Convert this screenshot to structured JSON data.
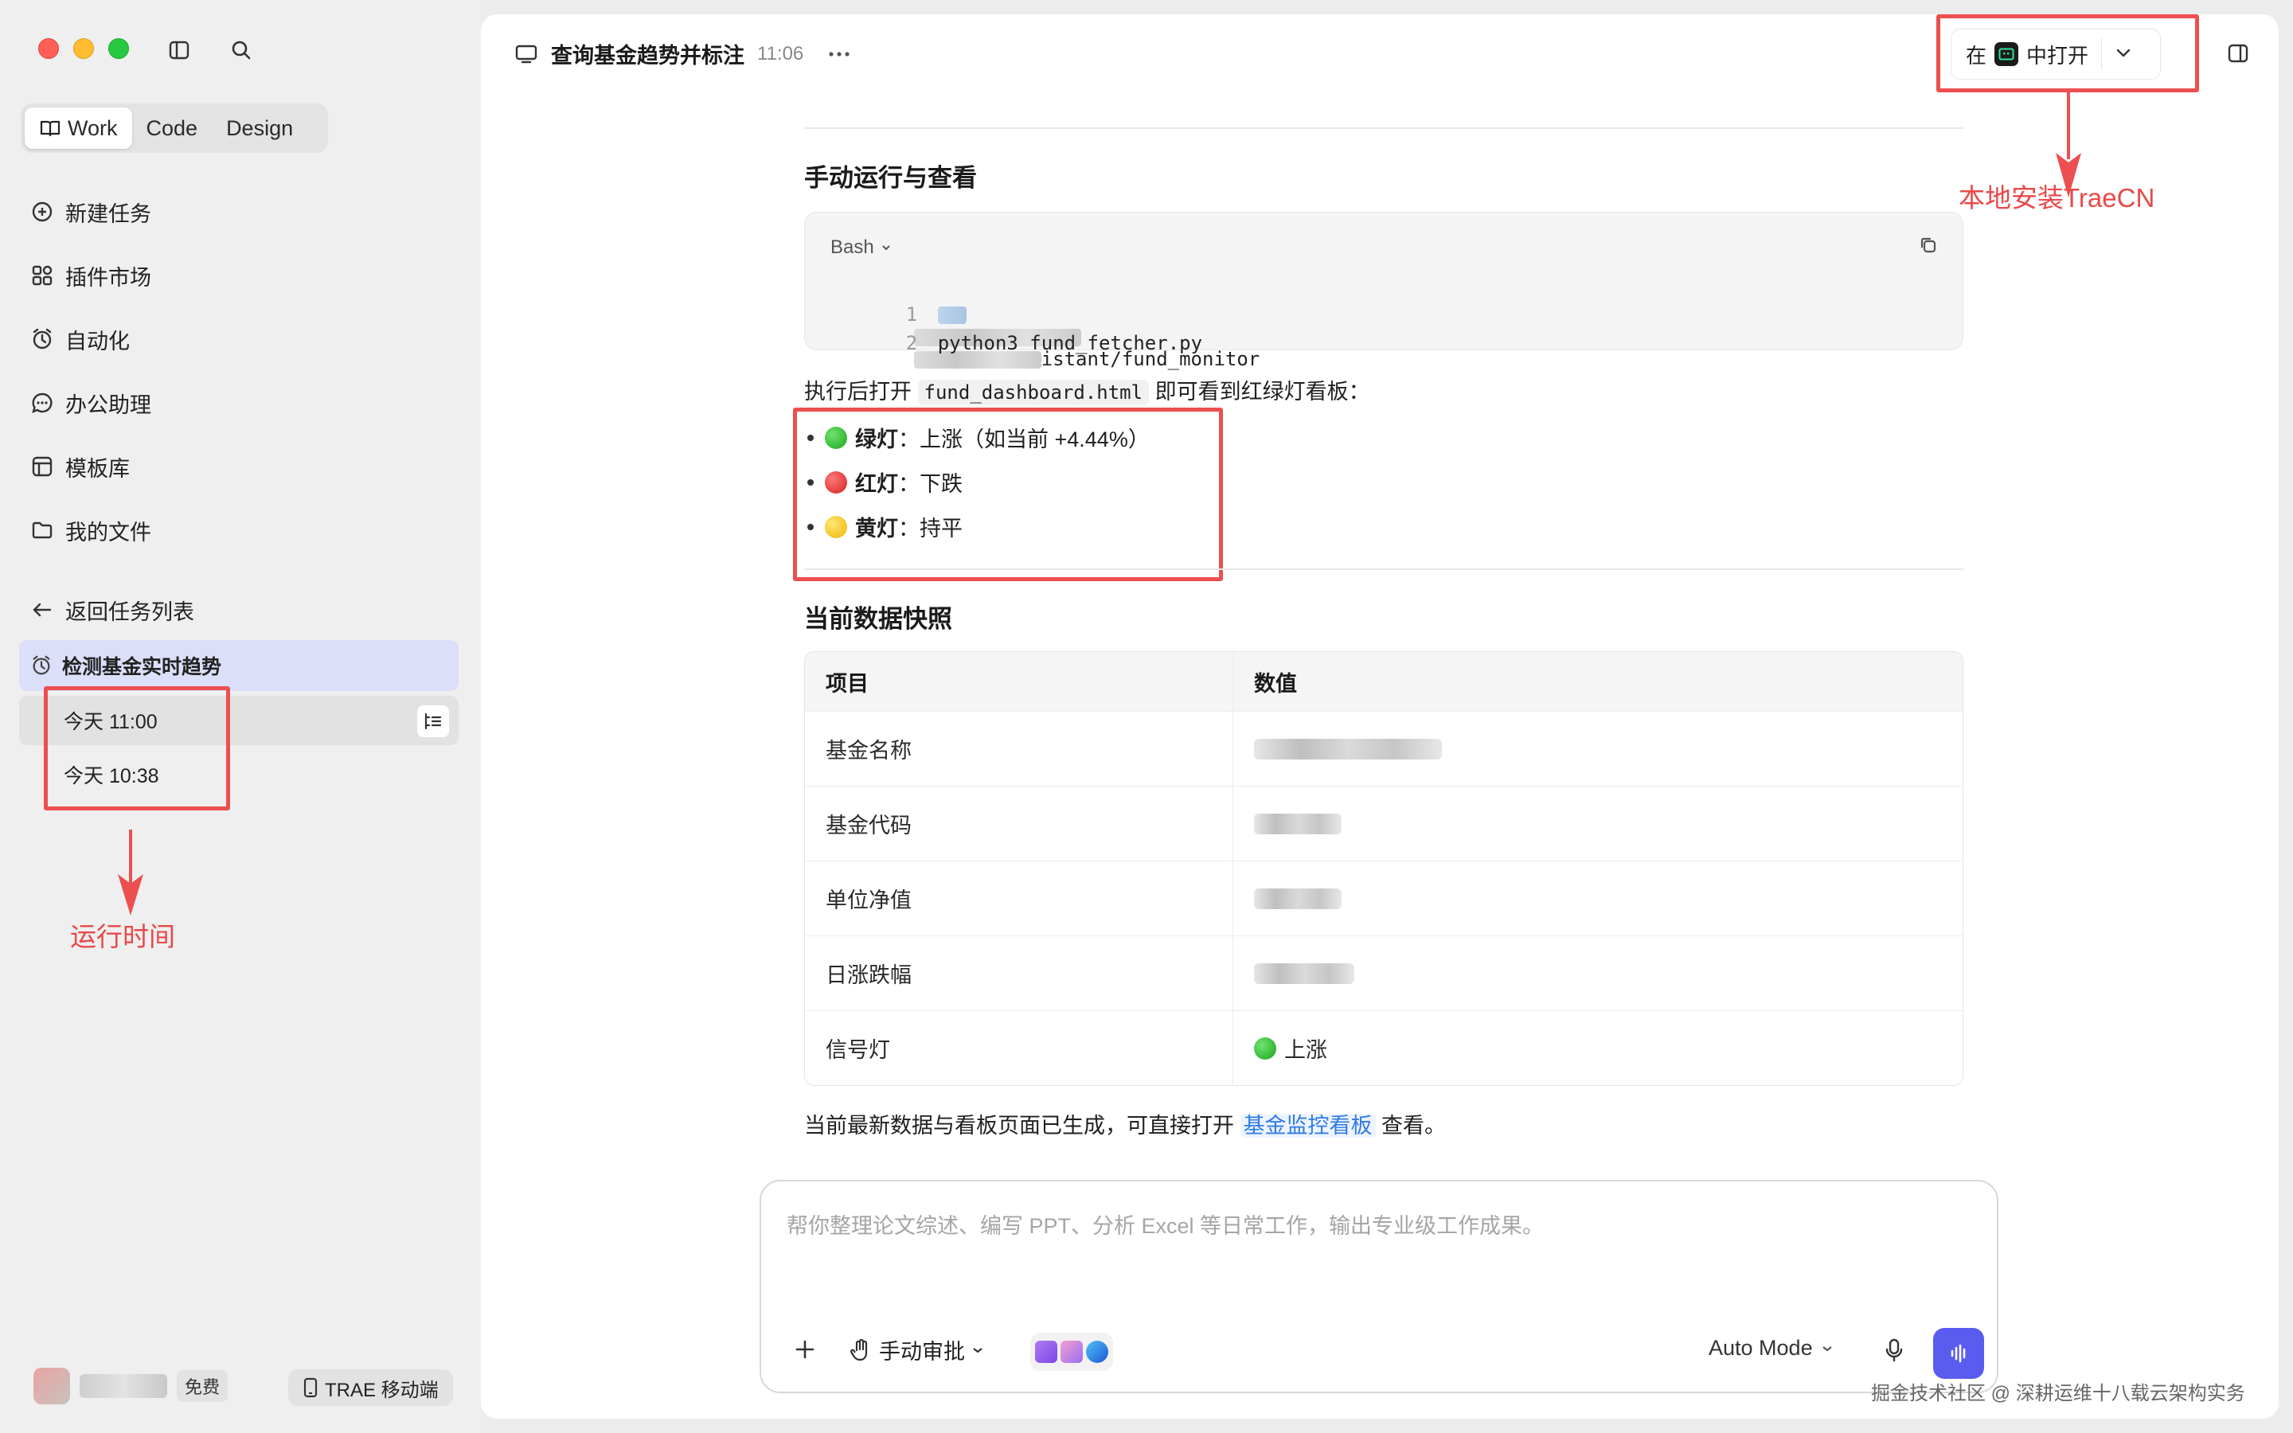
{
  "sidebar": {
    "modes": [
      "Work",
      "Code",
      "Design"
    ],
    "nav": [
      {
        "label": "新建任务",
        "icon": "plus-circle-icon"
      },
      {
        "label": "插件市场",
        "icon": "plugins-icon"
      },
      {
        "label": "自动化",
        "icon": "clock-icon"
      },
      {
        "label": "办公助理",
        "icon": "chat-icon"
      },
      {
        "label": "模板库",
        "icon": "template-icon"
      },
      {
        "label": "我的文件",
        "icon": "folder-icon"
      }
    ],
    "back_label": "返回任务列表",
    "task_group": "检测基金实时趋势",
    "runs": [
      "今天 11:00",
      "今天 10:38"
    ],
    "run_annotation": "运行时间",
    "free_badge": "免费",
    "mobile_label": "TRAE 移动端"
  },
  "header": {
    "title": "查询基金趋势并标注",
    "time": "11:06",
    "open_prefix": "在",
    "open_suffix": "中打开",
    "annotation": "本地安装TraeCN"
  },
  "content": {
    "section1_title": "手动运行与查看",
    "code_lang": "Bash",
    "code_line1_tail": "istant/fund_monitor",
    "code_line2": "python3 fund_fetcher.py",
    "after_run_prefix": "执行后打开",
    "after_run_file": "fund_dashboard.html",
    "after_run_suffix": "即可看到红绿灯看板：",
    "bullets": [
      {
        "name": "绿灯",
        "desc": "：上涨（如当前 +4.44%）"
      },
      {
        "name": "红灯",
        "desc": "：下跌"
      },
      {
        "name": "黄灯",
        "desc": "：持平"
      }
    ],
    "section2_title": "当前数据快照",
    "table": {
      "headers": [
        "项目",
        "数值"
      ],
      "rows": [
        "基金名称",
        "基金代码",
        "单位净值",
        "日涨跌幅",
        "信号灯"
      ],
      "signal_value": "上涨"
    },
    "closing_prefix": "当前最新数据与看板页面已生成，可直接打开",
    "closing_link": "基金监控看板",
    "closing_suffix": "查看。"
  },
  "composer": {
    "placeholder": "帮你整理论文综述、编写 PPT、分析 Excel 等日常工作，输出专业级工作成果。",
    "approve_label": "手动审批",
    "mode_label": "Auto Mode"
  },
  "watermark": "掘金技术社区 @ 深耕运维十八载云架构实务",
  "colors": {
    "accent": "#5a5cf0",
    "annotation": "#ec4f4f",
    "link": "#2f7be5",
    "task_group_bg": "#dcdff9"
  }
}
